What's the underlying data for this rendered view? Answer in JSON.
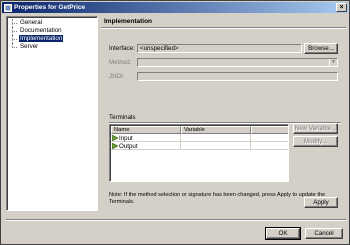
{
  "window": {
    "title": "Properties for GetPrice",
    "close_label": "×"
  },
  "tree": {
    "items": [
      {
        "label": "General",
        "selected": false
      },
      {
        "label": "Documentation",
        "selected": false
      },
      {
        "label": "Implementation",
        "selected": true
      },
      {
        "label": "Server",
        "selected": false
      }
    ]
  },
  "panel": {
    "header": "Implementation",
    "interface_label": "Interface:",
    "interface_value": "<unspecified>",
    "browse_label": "Browse...",
    "method_label": "Method:",
    "method_value": "",
    "jndi_label": "JNDI:",
    "jndi_value": "",
    "terminals_label": "Terminals",
    "table": {
      "columns": [
        "Name",
        "Variable",
        ""
      ],
      "rows": [
        {
          "name": "Input",
          "variable": ""
        },
        {
          "name": "Output",
          "variable": ""
        }
      ]
    },
    "new_variable_label": "New Variable...",
    "modify_label": "Modify...",
    "note": "Note: If the method selection or signature has been changed, press Apply to update the Terminals.",
    "apply_label": "Apply"
  },
  "footer": {
    "ok_label": "OK",
    "cancel_label": "Cancel"
  },
  "colors": {
    "titlebar_start": "#0a246a",
    "titlebar_end": "#a6caf0",
    "selection": "#0a246a",
    "terminal_icon": "#6b9e3a"
  }
}
